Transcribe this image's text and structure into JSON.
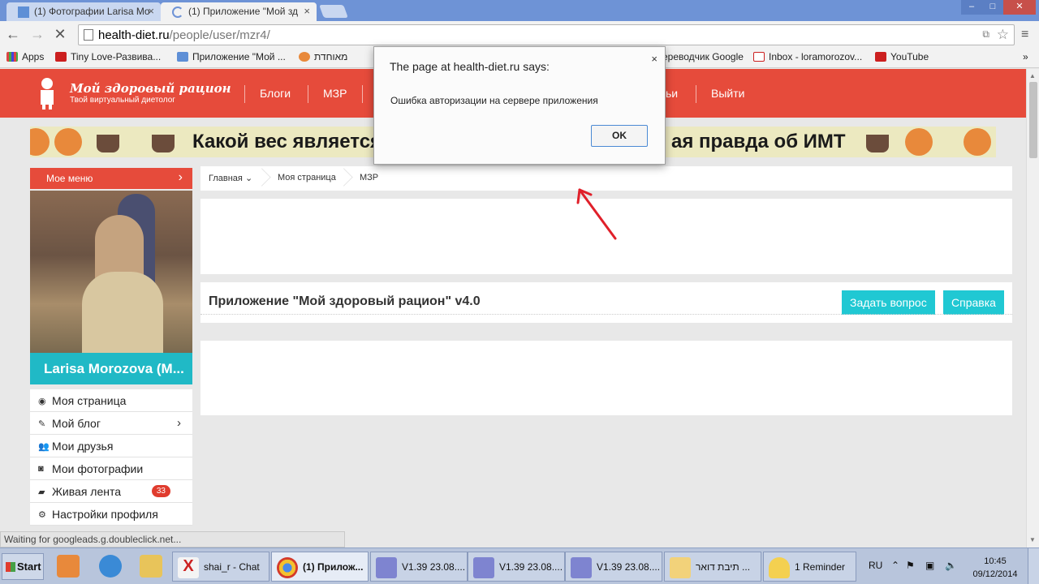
{
  "browser": {
    "tabs": [
      {
        "title": "(1) Фотографии Larisa Mo",
        "active": false
      },
      {
        "title": "(1) Приложение \"Мой зд",
        "active": true
      }
    ],
    "url_host": "health-diet.ru",
    "url_path": "/people/user/mzr4/",
    "bookmarks": [
      {
        "label": "Apps"
      },
      {
        "label": "Tiny Love-Развива..."
      },
      {
        "label": "Приложение \"Мой ..."
      },
      {
        "label": "מאוחדת"
      },
      {
        "label": "ереводчик Google"
      },
      {
        "label": "Inbox - loramorozov..."
      },
      {
        "label": "YouTube"
      }
    ],
    "overflow": "»"
  },
  "site": {
    "logo_title": "Мой здоровый рацион",
    "logo_sub": "Твой виртуальный диетолог",
    "nav": [
      "Блоги",
      "МЗР",
      "ьи",
      "Выйти"
    ],
    "banner_left": "Какой вес является",
    "banner_right": "ая правда об ИМТ",
    "menu_head": "Мое меню",
    "user_name": "Larisa Morozova (M...",
    "side_menu": [
      {
        "label": "Моя страница",
        "icon": "user-icon"
      },
      {
        "label": "Мой блог",
        "icon": "edit-icon",
        "chevron": true
      },
      {
        "label": "Мои друзья",
        "icon": "friends-icon"
      },
      {
        "label": "Мои фотографии",
        "icon": "camera-icon"
      },
      {
        "label": "Живая лента",
        "icon": "chat-icon",
        "badge": "33"
      },
      {
        "label": "Настройки профиля",
        "icon": "gear-icon"
      }
    ],
    "breadcrumbs": [
      "Главная",
      "Моя страница",
      "МЗР"
    ],
    "app_title": "Приложение \"Мой здоровый рацион\" v4.0",
    "ask_button": "Задать вопрос",
    "help_button": "Справка"
  },
  "dialog": {
    "title": "The page at health-diet.ru says:",
    "message": "Ошибка авторизации на сервере приложения",
    "ok": "OK",
    "close": "×"
  },
  "status": "Waiting for googleads.g.doubleclick.net...",
  "taskbar": {
    "start": "Start",
    "tasks": [
      {
        "label": "shai_r - Chat"
      },
      {
        "label": "(1) Прилож..."
      },
      {
        "label": "V1.39   23.08...."
      },
      {
        "label": "V1.39   23.08...."
      },
      {
        "label": "V1.39   23.08...."
      },
      {
        "label": "תיבת דואר ..."
      },
      {
        "label": "1 Reminder"
      }
    ],
    "lang": "RU",
    "time": "10:45",
    "date": "09/12/2014"
  },
  "colors": {
    "brand_red": "#e64b3b",
    "accent_teal": "#20b9c6",
    "button_cyan": "#20c8d3"
  }
}
